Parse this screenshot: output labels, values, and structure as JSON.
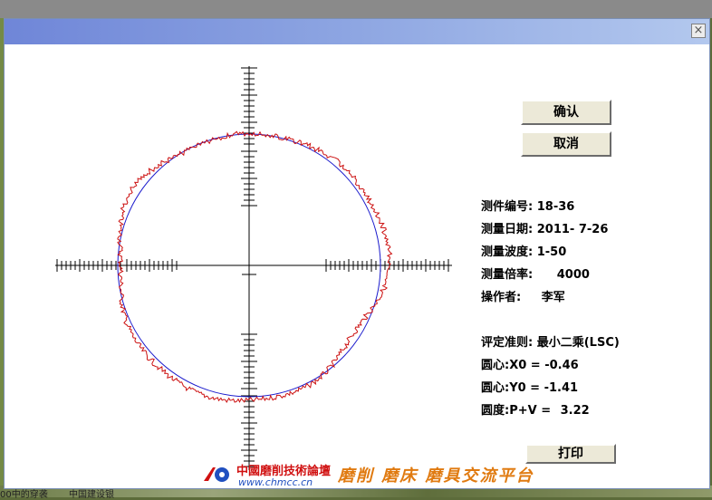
{
  "desktop": {
    "taskbar_items": [
      "00中的穿袭",
      "中国建设银"
    ]
  },
  "dialog": {
    "close_glyph": "×",
    "buttons": {
      "confirm": "确认",
      "cancel": "取消",
      "print": "打印"
    },
    "info": {
      "part_no_label": "测件编号:",
      "part_no": "18-36",
      "date_label": "测量日期:",
      "date": "2011- 7-26",
      "wave_label": "测量波度:",
      "wave": "1-50",
      "magnification_label": "测量倍率:",
      "magnification": "4000",
      "operator_label": "操作者:",
      "operator": "李军",
      "criterion_label": "评定准则:",
      "criterion": "最小二乘(LSC)",
      "x0_label": "圆心:X0  =",
      "x0": "-0.46",
      "y0_label": "圆心:Y0  =",
      "y0": "-1.41",
      "roundness_label": "圆度:P+V =",
      "roundness": "3.22"
    }
  },
  "plot": {
    "circle_color": "#1a1acc",
    "profile_color": "#cc1010",
    "axis_color": "#000000"
  },
  "watermark": {
    "site_name": "中國磨削技術論壇",
    "url": "www.chmcc.cn",
    "slogan": "磨削 磨床 磨具交流平台",
    "logo": "gear-logo"
  }
}
